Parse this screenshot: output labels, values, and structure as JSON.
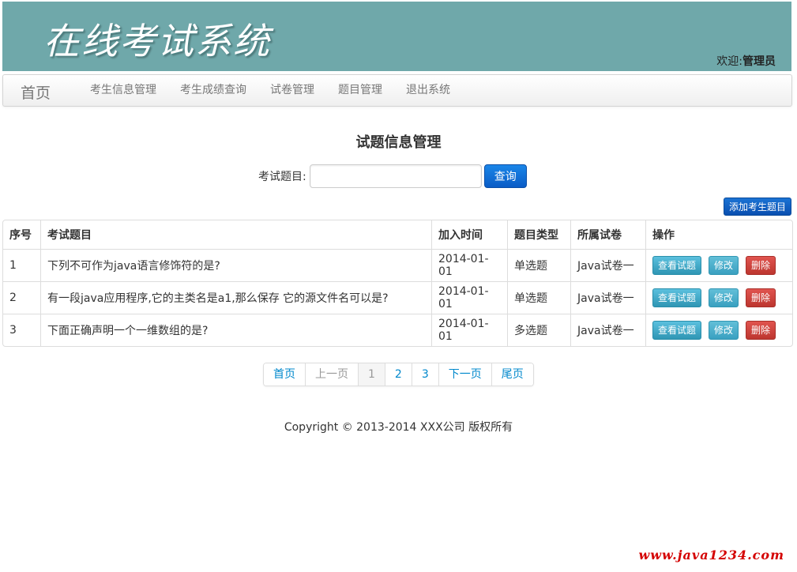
{
  "header": {
    "title": "在线考试系统",
    "welcome_prefix": "欢迎:",
    "welcome_user": "管理员"
  },
  "nav": {
    "brand": "首页",
    "items": [
      {
        "label": "考生信息管理"
      },
      {
        "label": "考生成绩查询"
      },
      {
        "label": "试卷管理"
      },
      {
        "label": "题目管理"
      },
      {
        "label": "退出系统"
      }
    ]
  },
  "main": {
    "title": "试题信息管理",
    "search_label": "考试题目:",
    "search_value": "",
    "search_button": "查询",
    "add_button": "添加考生题目"
  },
  "table": {
    "headers": [
      "序号",
      "考试题目",
      "加入时间",
      "题目类型",
      "所属试卷",
      "操作"
    ],
    "rows": [
      {
        "id": "1",
        "question": "下列不可作为java语言修饰符的是?",
        "date": "2014-01-01",
        "type": "单选题",
        "paper": "Java试卷一"
      },
      {
        "id": "2",
        "question": "有一段java应用程序,它的主类名是a1,那么保存 它的源文件名可以是?",
        "date": "2014-01-01",
        "type": "单选题",
        "paper": "Java试卷一"
      },
      {
        "id": "3",
        "question": "下面正确声明一个一维数组的是?",
        "date": "2014-01-01",
        "type": "多选题",
        "paper": "Java试卷一"
      }
    ],
    "actions": {
      "view": "查看试题",
      "edit": "修改",
      "delete": "删除"
    }
  },
  "pagination": {
    "first": "首页",
    "prev": "上一页",
    "pages": [
      "1",
      "2",
      "3"
    ],
    "next": "下一页",
    "last": "尾页"
  },
  "footer": {
    "copyright": "Copyright © 2013-2014 XXX公司 版权所有"
  },
  "watermark": "www.java1234.com",
  "colors": {
    "banner": "#6fa8aa",
    "primary": "#0a5cc6",
    "info": "#5bc0de",
    "danger": "#bd362f"
  }
}
